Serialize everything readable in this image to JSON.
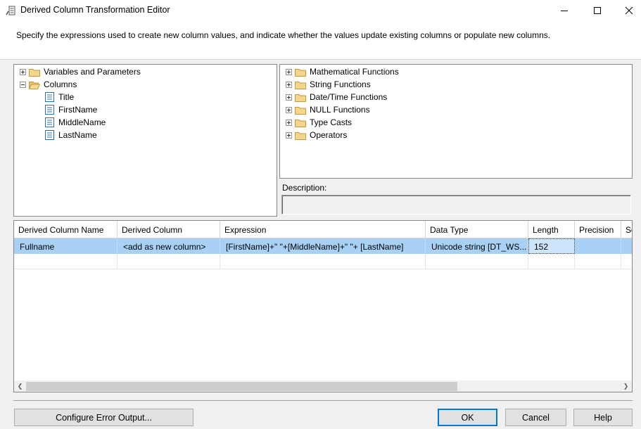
{
  "window": {
    "title": "Derived Column Transformation Editor",
    "controls": {
      "minimize": "minimize",
      "maximize": "maximize",
      "close": "close"
    }
  },
  "intro": {
    "text": "Specify the expressions used to create new column values, and indicate whether the values update existing columns or populate new columns."
  },
  "left_tree": {
    "items": [
      {
        "label": "Variables and Parameters",
        "expander": "plus",
        "icon": "folder-icon"
      },
      {
        "label": "Columns",
        "expander": "minus",
        "icon": "folder-open-icon"
      }
    ],
    "columns": [
      "Title",
      "FirstName",
      "MiddleName",
      "LastName"
    ]
  },
  "right_tree": {
    "items": [
      {
        "label": "Mathematical Functions"
      },
      {
        "label": "String Functions"
      },
      {
        "label": "Date/Time Functions"
      },
      {
        "label": "NULL Functions"
      },
      {
        "label": "Type Casts"
      },
      {
        "label": "Operators"
      }
    ]
  },
  "description": {
    "label": "Description:",
    "value": ""
  },
  "grid": {
    "headers": [
      "Derived Column Name",
      "Derived Column",
      "Expression",
      "Data Type",
      "Length",
      "Precision",
      "Sc"
    ],
    "rows": [
      {
        "name": "Fullname",
        "derived": "<add as new column>",
        "expression": "[FirstName]+\" \"+[MiddleName]+\" \"+ [LastName]",
        "data_type": "Unicode string [DT_WS...",
        "length": "152",
        "precision": "",
        "scale": ""
      }
    ]
  },
  "buttons": {
    "configure_error_output": "Configure Error Output...",
    "ok": "OK",
    "cancel": "Cancel",
    "help": "Help"
  },
  "colors": {
    "selected_row": "#a9d1f5",
    "ok_border": "#0078d7",
    "folder": "#dcb67a"
  }
}
